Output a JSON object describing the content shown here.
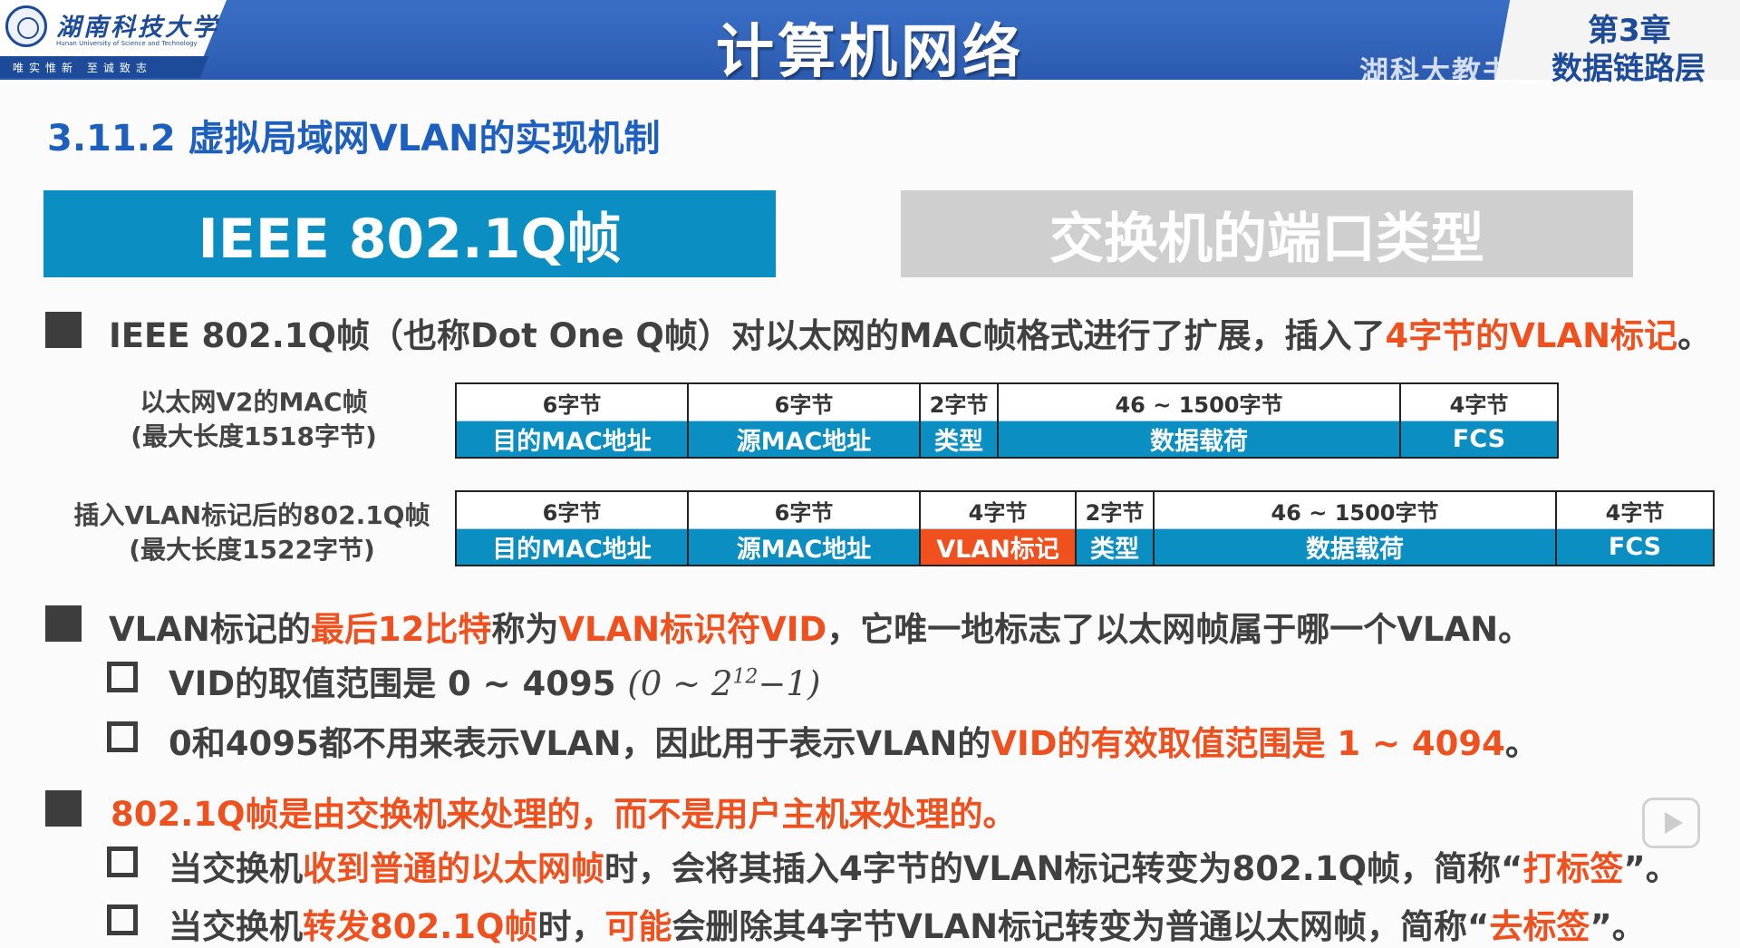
{
  "header": {
    "logo_name": "湖南科技大学",
    "logo_english": "Hunan University of Science and Technology",
    "logo_motto": "唯实惟新  至诚致志",
    "title": "计算机网络",
    "chapter_no": "第3章",
    "chapter_name": "数据链路层",
    "watermark": "湖科大教书匠"
  },
  "section": {
    "title": "3.11.2 虚拟局域网VLAN的实现机制"
  },
  "tabs": [
    {
      "label": "IEEE 802.1Q帧",
      "active": true
    },
    {
      "label": "交换机的端口类型",
      "active": false
    }
  ],
  "bullet1": {
    "text": "IEEE 802.1Q帧（也称Dot One Q帧）对以太网的MAC帧格式进行了扩展，插入了",
    "hl": "4字节的VLAN标记",
    "end": "。"
  },
  "frame1": {
    "label_line1": "以太网V2的MAC帧",
    "label_line2": "(最大长度1518字节)",
    "fields": [
      {
        "bytes": "6字节",
        "name": "目的MAC地址"
      },
      {
        "bytes": "6字节",
        "name": "源MAC地址"
      },
      {
        "bytes": "2字节",
        "name": "类型"
      },
      {
        "bytes": "46 ~ 1500字节",
        "name": "数据载荷"
      },
      {
        "bytes": "4字节",
        "name": "FCS"
      }
    ]
  },
  "frame2": {
    "label_line1": "插入VLAN标记后的802.1Q帧",
    "label_line2": "(最大长度1522字节)",
    "fields": [
      {
        "bytes": "6字节",
        "name": "目的MAC地址"
      },
      {
        "bytes": "6字节",
        "name": "源MAC地址"
      },
      {
        "bytes": "4字节",
        "name": "VLAN标记"
      },
      {
        "bytes": "2字节",
        "name": "类型"
      },
      {
        "bytes": "46 ~ 1500字节",
        "name": "数据载荷"
      },
      {
        "bytes": "4字节",
        "name": "FCS"
      }
    ]
  },
  "bullet2": {
    "t1": "VLAN标记的",
    "h1": "最后12比特",
    "t2": "称为",
    "h2": "VLAN标识符VID",
    "t3": "，它唯一地标志了以太网帧属于哪一个VLAN。",
    "sub1": "VID的取值范围是 0 ~ 4095",
    "sub1_math_a": "(0  ~  2",
    "sub1_math_exp": "12",
    "sub1_math_b": "−1)",
    "sub2_t": "0和4095都不用来表示VLAN，因此用于表示VLAN的",
    "sub2_h": "VID的有效取值范围是 1 ~ 4094",
    "sub2_end": "。"
  },
  "bullet3": {
    "hl": "802.1Q帧是由交换机来处理的，而不是用户主机来处理的。",
    "sub1_t1": "当交换机",
    "sub1_h1": "收到普通的以太网帧",
    "sub1_t2": "时，会将其插入4字节的VLAN标记转变为802.1Q帧，简称“",
    "sub1_h2": "打标签",
    "sub1_end": "”。",
    "sub2_t1": "当交换机",
    "sub2_h1": "转发802.1Q帧",
    "sub2_t2": "时，",
    "sub2_h2": "可能",
    "sub2_t3": "会删除其4字节VLAN标记转变为普通以太网帧，简称“",
    "sub2_h3": "去标签",
    "sub2_end": "”。"
  },
  "colors": {
    "header_blue": "#2f62b8",
    "tab_active": "#0b8fc3",
    "tab_inactive": "#cfcfcf",
    "highlight": "#f0501e",
    "title_blue": "#1d5fbf"
  }
}
